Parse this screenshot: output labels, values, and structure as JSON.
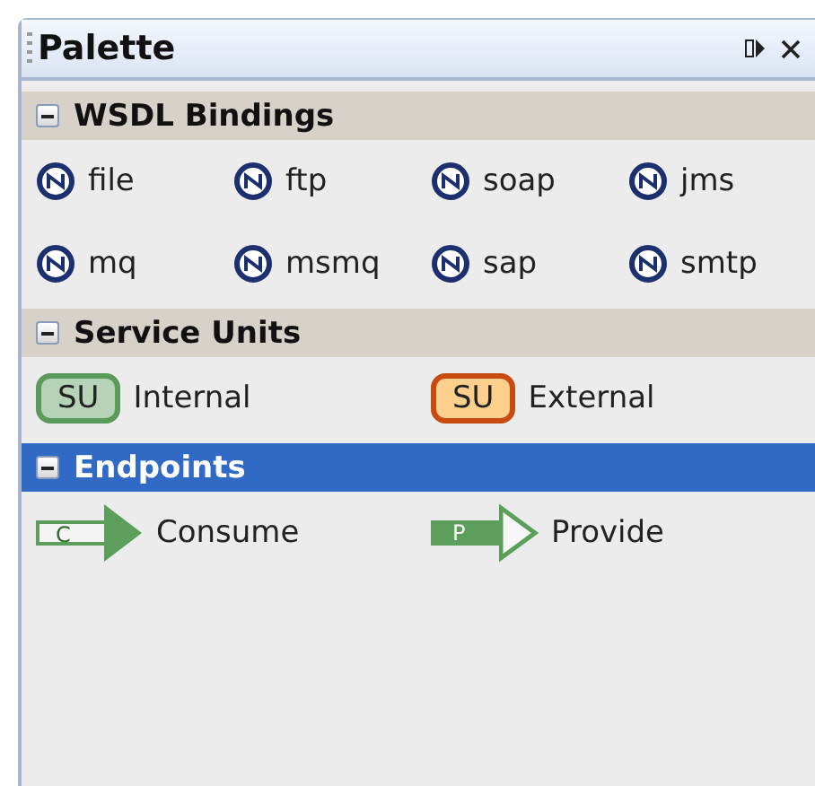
{
  "panel": {
    "title": "Palette"
  },
  "categories": [
    {
      "label": "WSDL Bindings",
      "expanded": true,
      "selected": false,
      "items": [
        {
          "kind": "binding",
          "label": "file"
        },
        {
          "kind": "binding",
          "label": "ftp"
        },
        {
          "kind": "binding",
          "label": "soap"
        },
        {
          "kind": "binding",
          "label": "jms"
        },
        {
          "kind": "binding",
          "label": "mq"
        },
        {
          "kind": "binding",
          "label": "msmq"
        },
        {
          "kind": "binding",
          "label": "sap"
        },
        {
          "kind": "binding",
          "label": "smtp"
        }
      ]
    },
    {
      "label": "Service Units",
      "expanded": true,
      "selected": false,
      "items": [
        {
          "kind": "service-unit",
          "badge": "SU",
          "label": "Internal",
          "color": "#5a9a5a"
        },
        {
          "kind": "service-unit",
          "badge": "SU",
          "label": "External",
          "color": "#c84a10"
        }
      ]
    },
    {
      "label": "Endpoints",
      "expanded": true,
      "selected": true,
      "items": [
        {
          "kind": "consume",
          "badge": "C",
          "label": "Consume"
        },
        {
          "kind": "provide",
          "badge": "P",
          "label": "Provide"
        }
      ]
    }
  ]
}
